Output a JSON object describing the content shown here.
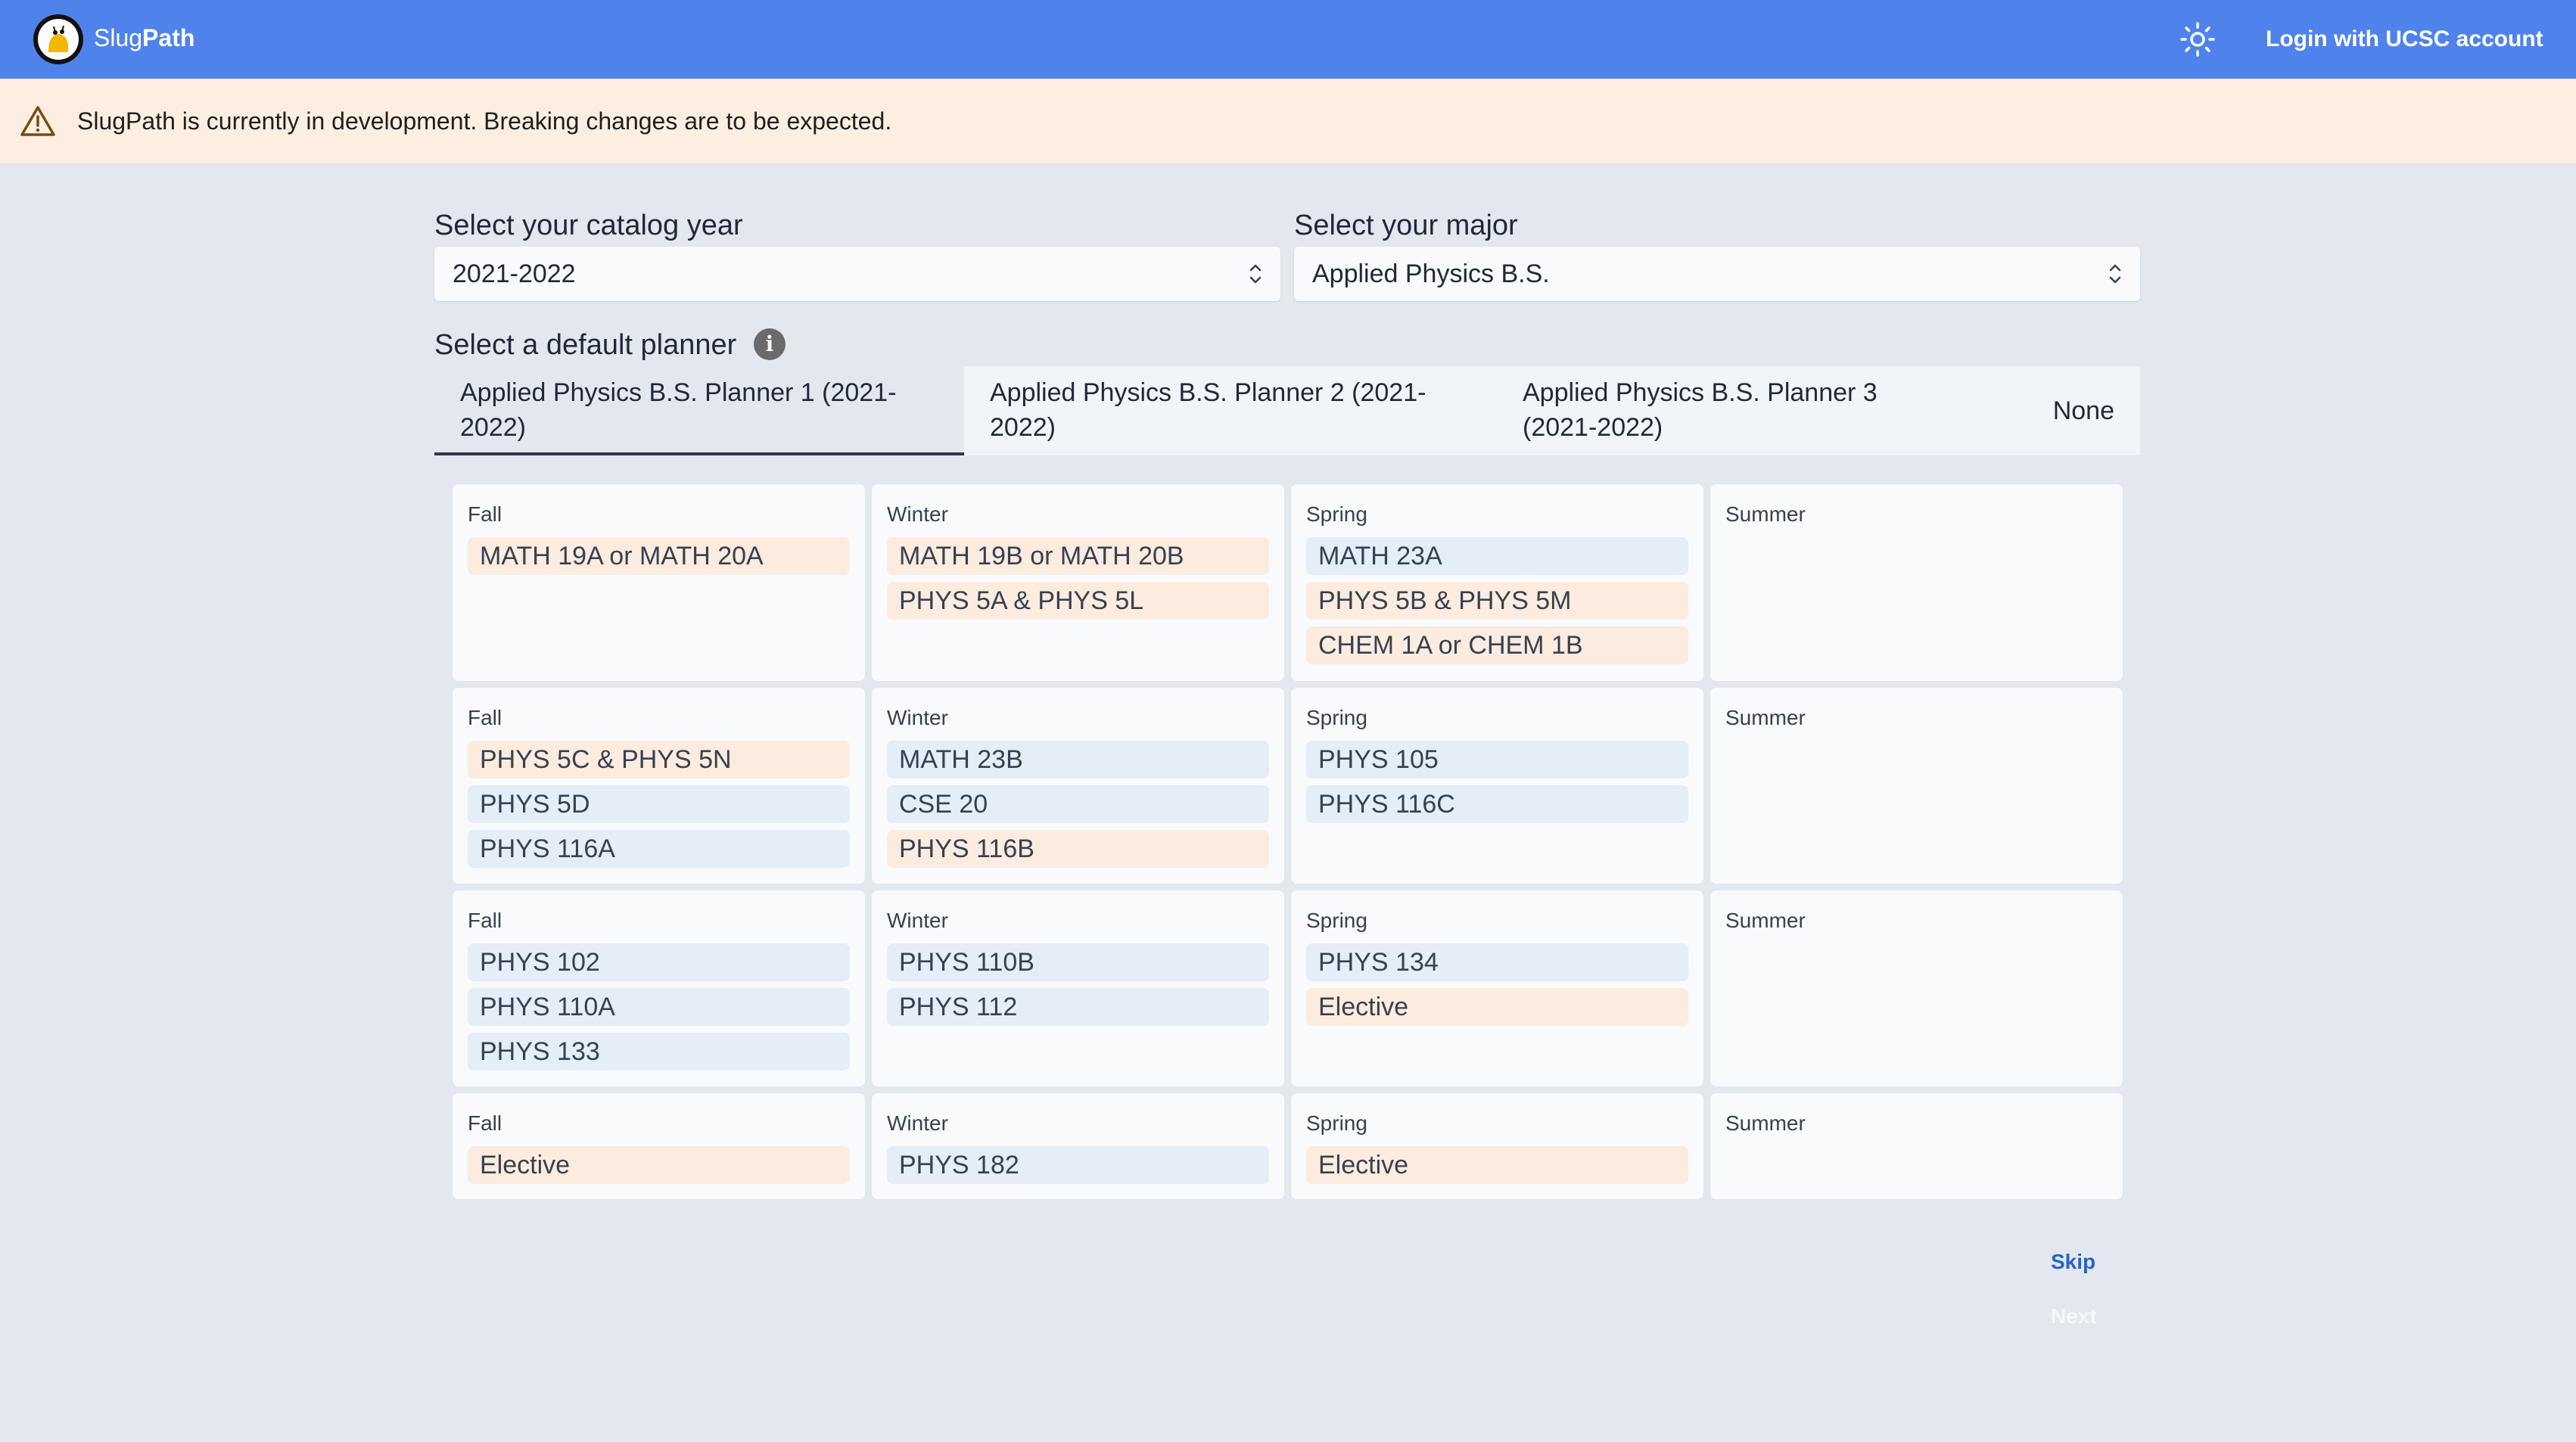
{
  "header": {
    "brand_regular": "Slug",
    "brand_bold": "Path",
    "login_label": "Login with UCSC account",
    "theme_icon": "sun-icon",
    "logo_icon": "slug-logo-icon"
  },
  "banner": {
    "icon": "warning-icon",
    "text": "SlugPath is currently in development. Breaking changes are to be expected."
  },
  "catalog": {
    "label": "Select your catalog year",
    "value": "2021-2022"
  },
  "major": {
    "label": "Select your major",
    "value": "Applied Physics B.S."
  },
  "planner": {
    "label": "Select a default planner",
    "tabs": [
      {
        "label": "Applied Physics B.S. Planner 1 (2021-2022)"
      },
      {
        "label": "Applied Physics B.S. Planner 2 (2021-2022)"
      },
      {
        "label": "Applied Physics B.S. Planner 3 (2021-2022)"
      },
      {
        "label": "None"
      }
    ],
    "active_tab": 0
  },
  "years": [
    {
      "quarters": [
        {
          "label": "Fall",
          "courses": [
            {
              "name": "MATH 19A or MATH 20A",
              "kind": "req"
            }
          ]
        },
        {
          "label": "Winter",
          "courses": [
            {
              "name": "MATH 19B or MATH 20B",
              "kind": "req"
            },
            {
              "name": "PHYS 5A & PHYS 5L",
              "kind": "req"
            }
          ]
        },
        {
          "label": "Spring",
          "courses": [
            {
              "name": "MATH 23A",
              "kind": "opt"
            },
            {
              "name": "PHYS 5B & PHYS 5M",
              "kind": "req"
            },
            {
              "name": "CHEM 1A or CHEM 1B",
              "kind": "req"
            }
          ]
        },
        {
          "label": "Summer",
          "courses": []
        }
      ]
    },
    {
      "quarters": [
        {
          "label": "Fall",
          "courses": [
            {
              "name": "PHYS 5C & PHYS 5N",
              "kind": "req"
            },
            {
              "name": "PHYS 5D",
              "kind": "opt"
            },
            {
              "name": "PHYS 116A",
              "kind": "opt"
            }
          ]
        },
        {
          "label": "Winter",
          "courses": [
            {
              "name": "MATH 23B",
              "kind": "opt"
            },
            {
              "name": "CSE 20",
              "kind": "opt"
            },
            {
              "name": "PHYS 116B",
              "kind": "req"
            }
          ]
        },
        {
          "label": "Spring",
          "courses": [
            {
              "name": "PHYS 105",
              "kind": "opt"
            },
            {
              "name": "PHYS 116C",
              "kind": "opt"
            }
          ]
        },
        {
          "label": "Summer",
          "courses": []
        }
      ]
    },
    {
      "quarters": [
        {
          "label": "Fall",
          "courses": [
            {
              "name": "PHYS 102",
              "kind": "opt"
            },
            {
              "name": "PHYS 110A",
              "kind": "opt"
            },
            {
              "name": "PHYS 133",
              "kind": "opt"
            }
          ]
        },
        {
          "label": "Winter",
          "courses": [
            {
              "name": "PHYS 110B",
              "kind": "opt"
            },
            {
              "name": "PHYS 112",
              "kind": "opt"
            }
          ]
        },
        {
          "label": "Spring",
          "courses": [
            {
              "name": "PHYS 134",
              "kind": "opt"
            },
            {
              "name": "Elective",
              "kind": "req"
            }
          ]
        },
        {
          "label": "Summer",
          "courses": []
        }
      ]
    },
    {
      "quarters": [
        {
          "label": "Fall",
          "courses": [
            {
              "name": "Elective",
              "kind": "req"
            }
          ]
        },
        {
          "label": "Winter",
          "courses": [
            {
              "name": "PHYS 182",
              "kind": "opt"
            }
          ]
        },
        {
          "label": "Spring",
          "courses": [
            {
              "name": "Elective",
              "kind": "req"
            }
          ]
        },
        {
          "label": "Summer",
          "courses": []
        }
      ]
    }
  ],
  "actions": {
    "skip_label": "Skip",
    "next_label": "Next"
  },
  "colors": {
    "header": "#4f83eb",
    "banner": "#fcefe2",
    "course_req": "#fcecdf",
    "course_opt": "#e5edf7",
    "link": "#2563c9"
  }
}
